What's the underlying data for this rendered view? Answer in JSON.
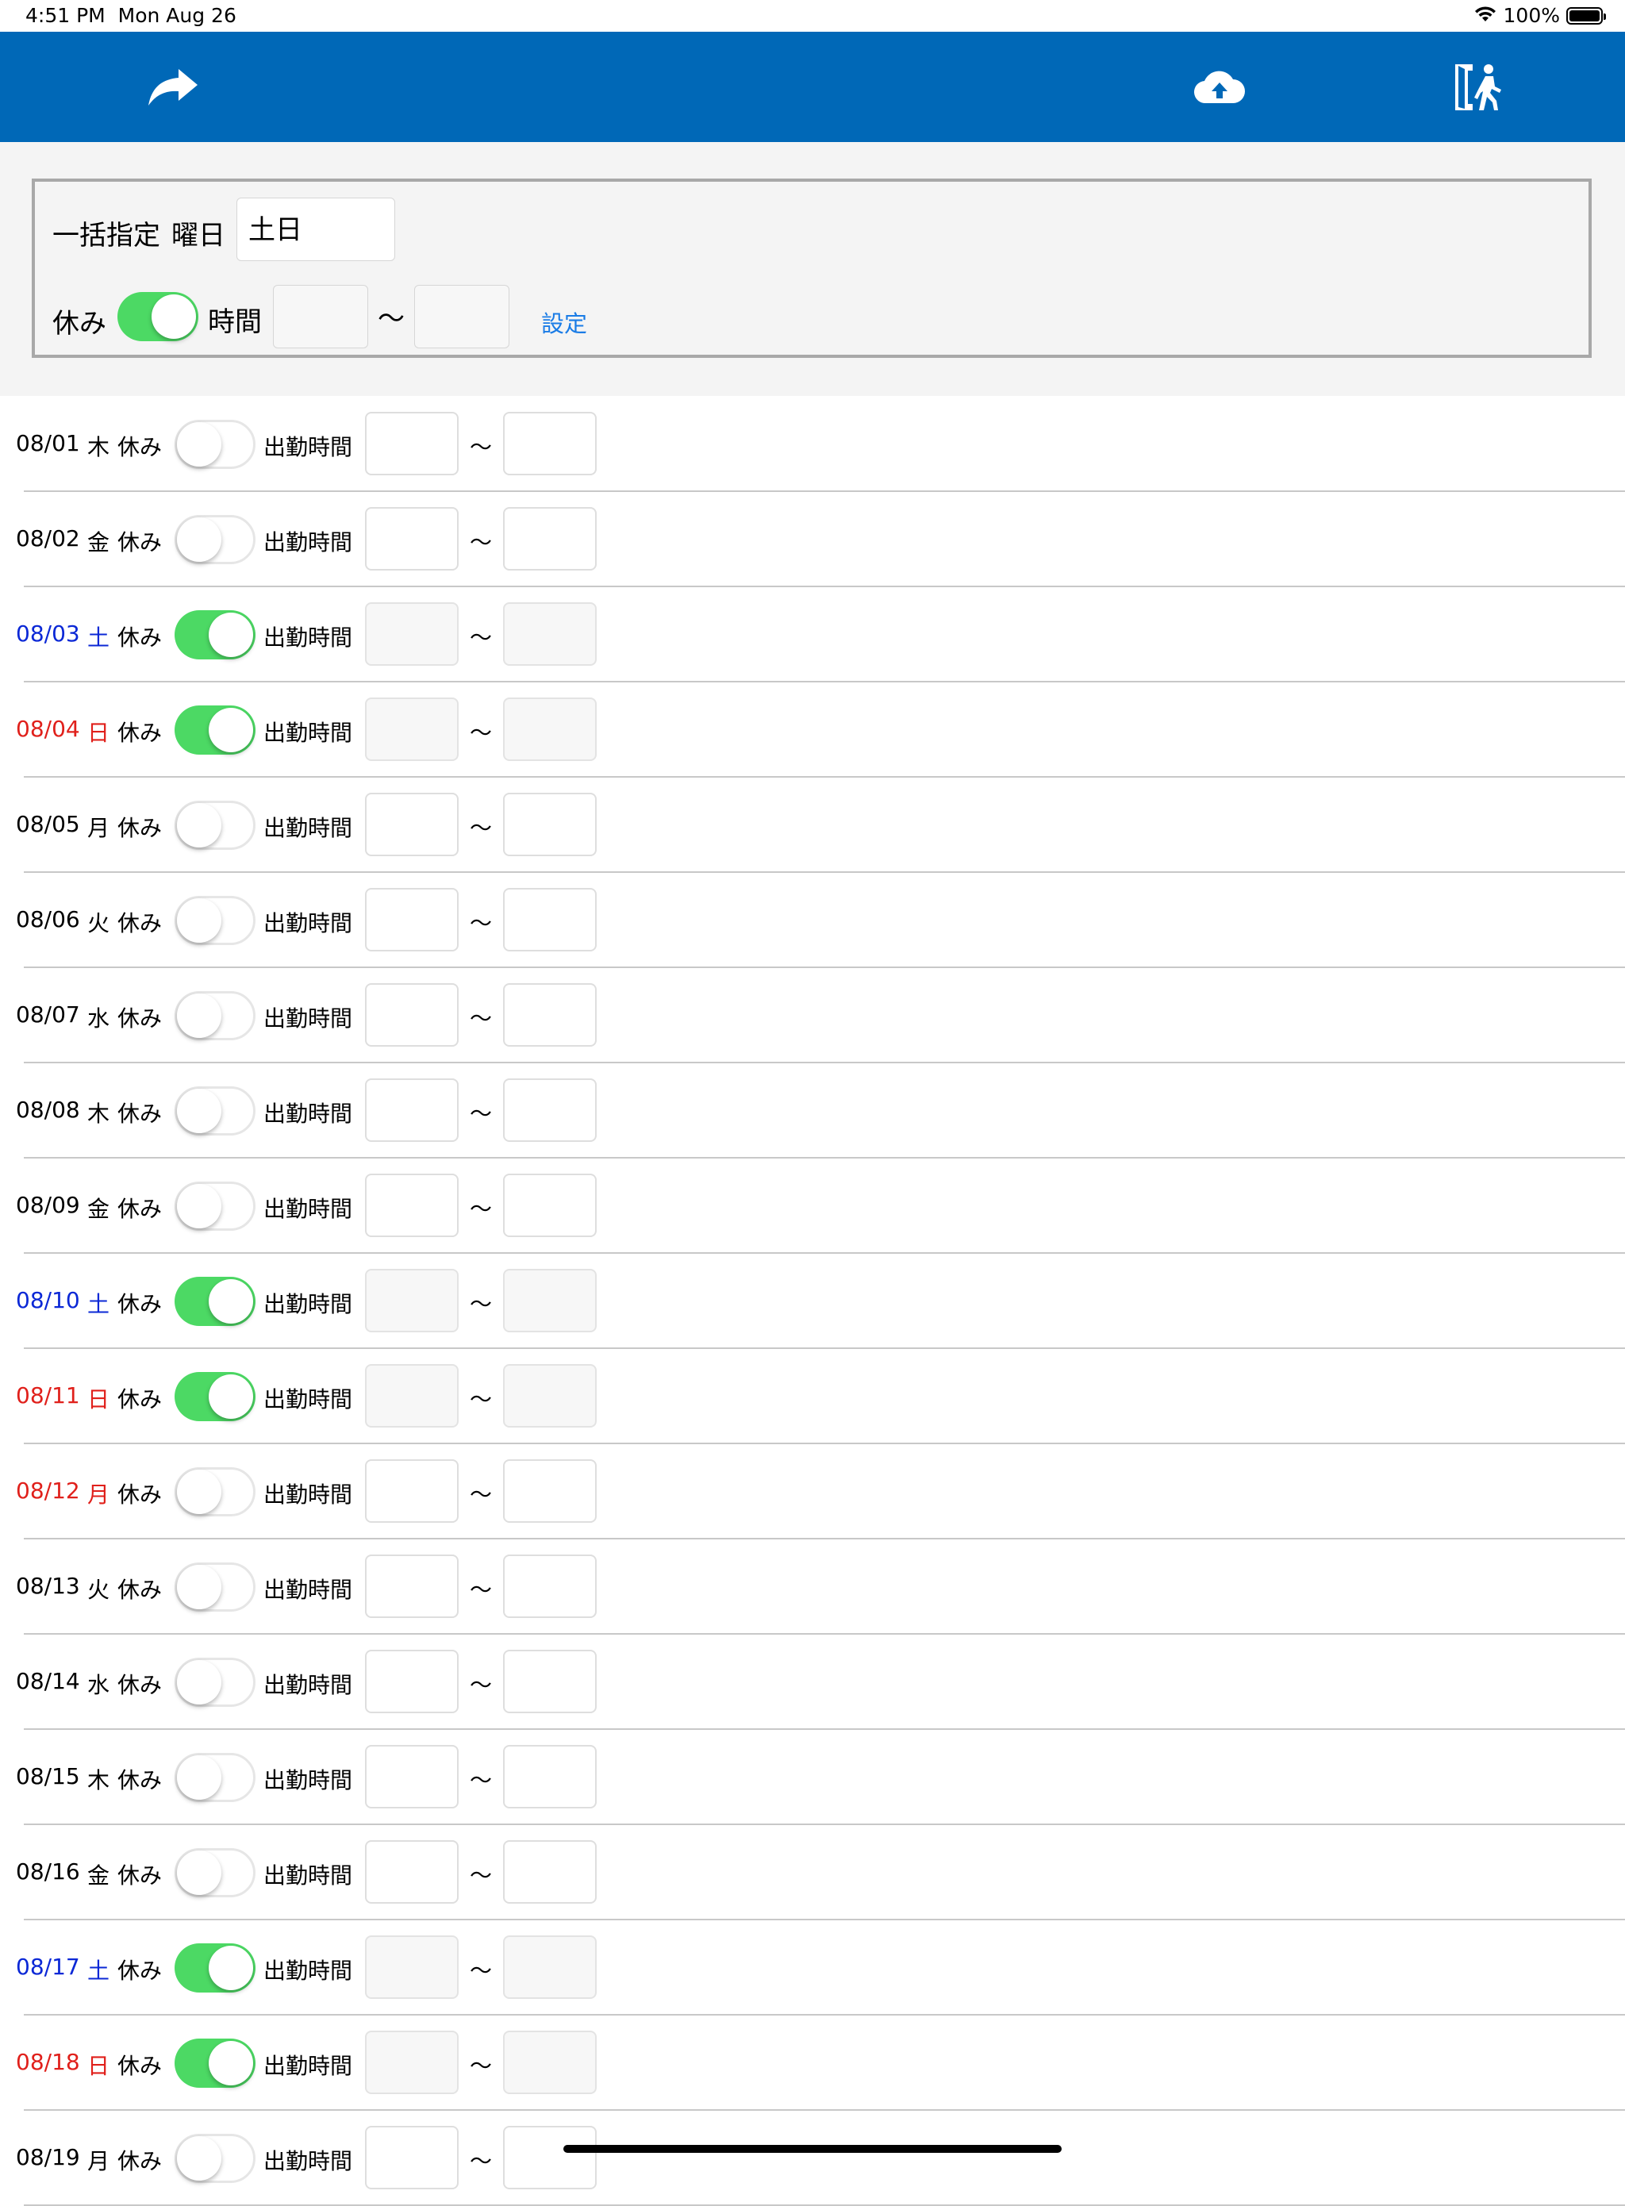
{
  "status_bar": {
    "time": "4:51 PM",
    "date": "Mon Aug 26",
    "battery": "100%"
  },
  "toolbar": {
    "background": "#0068b7",
    "icons": [
      "share-arrow-icon",
      "cloud-upload-icon",
      "exit-door-icon"
    ]
  },
  "bulk": {
    "label": "一括指定",
    "weekday_label": "曜日",
    "weekday_value": "土日",
    "rest_label": "休み",
    "rest_on": true,
    "time_label": "時間",
    "tilde": "〜",
    "set_button": "設定"
  },
  "colors": {
    "saturday": "#0b28d6",
    "sunday_holiday": "#e0201b",
    "toggle_on": "#4cd964"
  },
  "days": [
    {
      "date": "08/01",
      "weekday": "木",
      "rest_label": "休み",
      "rest_on": false,
      "work_label": "出勤時間",
      "tilde": "〜",
      "color": "black"
    },
    {
      "date": "08/02",
      "weekday": "金",
      "rest_label": "休み",
      "rest_on": false,
      "work_label": "出勤時間",
      "tilde": "〜",
      "color": "black"
    },
    {
      "date": "08/03",
      "weekday": "土",
      "rest_label": "休み",
      "rest_on": true,
      "work_label": "出勤時間",
      "tilde": "〜",
      "color": "blue"
    },
    {
      "date": "08/04",
      "weekday": "日",
      "rest_label": "休み",
      "rest_on": true,
      "work_label": "出勤時間",
      "tilde": "〜",
      "color": "red"
    },
    {
      "date": "08/05",
      "weekday": "月",
      "rest_label": "休み",
      "rest_on": false,
      "work_label": "出勤時間",
      "tilde": "〜",
      "color": "black"
    },
    {
      "date": "08/06",
      "weekday": "火",
      "rest_label": "休み",
      "rest_on": false,
      "work_label": "出勤時間",
      "tilde": "〜",
      "color": "black"
    },
    {
      "date": "08/07",
      "weekday": "水",
      "rest_label": "休み",
      "rest_on": false,
      "work_label": "出勤時間",
      "tilde": "〜",
      "color": "black"
    },
    {
      "date": "08/08",
      "weekday": "木",
      "rest_label": "休み",
      "rest_on": false,
      "work_label": "出勤時間",
      "tilde": "〜",
      "color": "black"
    },
    {
      "date": "08/09",
      "weekday": "金",
      "rest_label": "休み",
      "rest_on": false,
      "work_label": "出勤時間",
      "tilde": "〜",
      "color": "black"
    },
    {
      "date": "08/10",
      "weekday": "土",
      "rest_label": "休み",
      "rest_on": true,
      "work_label": "出勤時間",
      "tilde": "〜",
      "color": "blue"
    },
    {
      "date": "08/11",
      "weekday": "日",
      "rest_label": "休み",
      "rest_on": true,
      "work_label": "出勤時間",
      "tilde": "〜",
      "color": "red"
    },
    {
      "date": "08/12",
      "weekday": "月",
      "rest_label": "休み",
      "rest_on": false,
      "work_label": "出勤時間",
      "tilde": "〜",
      "color": "red"
    },
    {
      "date": "08/13",
      "weekday": "火",
      "rest_label": "休み",
      "rest_on": false,
      "work_label": "出勤時間",
      "tilde": "〜",
      "color": "black"
    },
    {
      "date": "08/14",
      "weekday": "水",
      "rest_label": "休み",
      "rest_on": false,
      "work_label": "出勤時間",
      "tilde": "〜",
      "color": "black"
    },
    {
      "date": "08/15",
      "weekday": "木",
      "rest_label": "休み",
      "rest_on": false,
      "work_label": "出勤時間",
      "tilde": "〜",
      "color": "black"
    },
    {
      "date": "08/16",
      "weekday": "金",
      "rest_label": "休み",
      "rest_on": false,
      "work_label": "出勤時間",
      "tilde": "〜",
      "color": "black"
    },
    {
      "date": "08/17",
      "weekday": "土",
      "rest_label": "休み",
      "rest_on": true,
      "work_label": "出勤時間",
      "tilde": "〜",
      "color": "blue"
    },
    {
      "date": "08/18",
      "weekday": "日",
      "rest_label": "休み",
      "rest_on": true,
      "work_label": "出勤時間",
      "tilde": "〜",
      "color": "red"
    },
    {
      "date": "08/19",
      "weekday": "月",
      "rest_label": "休み",
      "rest_on": false,
      "work_label": "出勤時間",
      "tilde": "〜",
      "color": "black"
    }
  ]
}
